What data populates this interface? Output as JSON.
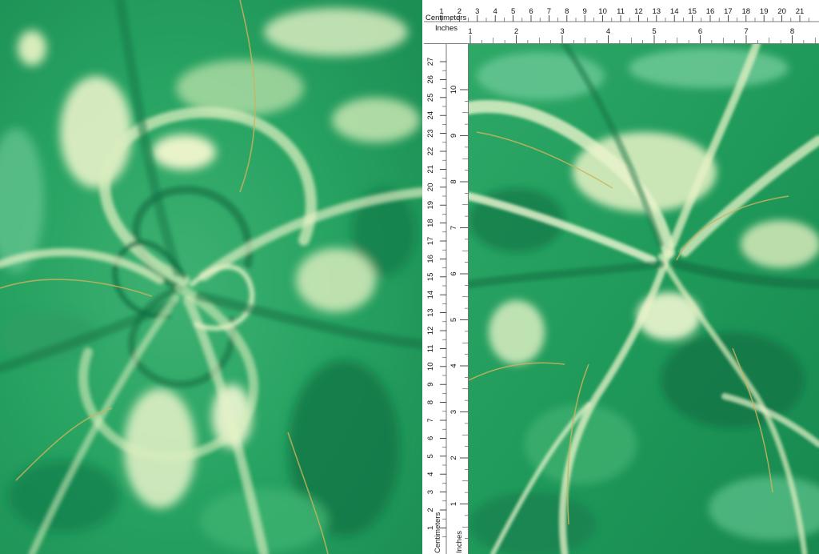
{
  "image": {
    "left_panel": "fabric-swirl-photo",
    "right_panel": "fabric-flat-swatch"
  },
  "palette": {
    "deep_green": "#0f7a48",
    "mid_green": "#2aa565",
    "light_green": "#5cc88b",
    "pale_cream": "#e9f3c7",
    "gold_vein": "#cdb35a"
  },
  "ruler": {
    "top_cm_label": "Centimeters",
    "top_in_label": "Inches",
    "side_cm_label": "Centimeters",
    "side_in_label": "Inches",
    "top_cm_ticks": [
      "1",
      "2",
      "3",
      "4",
      "5",
      "6",
      "7",
      "8",
      "9",
      "10",
      "11",
      "12",
      "13",
      "14",
      "15",
      "16",
      "17",
      "18",
      "19",
      "20",
      "21"
    ],
    "top_in_ticks": [
      "1",
      "2",
      "3",
      "4",
      "5",
      "6",
      "7",
      "8"
    ],
    "side_cm_ticks": [
      "27",
      "26",
      "25",
      "24",
      "23",
      "22",
      "21",
      "20",
      "19",
      "18",
      "17",
      "16",
      "15",
      "14",
      "13",
      "12",
      "11",
      "10",
      "9",
      "8",
      "7",
      "6",
      "5",
      "4",
      "3",
      "2",
      "1"
    ],
    "side_in_ticks": [
      "10",
      "9",
      "8",
      "7",
      "6",
      "5",
      "4",
      "3",
      "2",
      "1"
    ]
  }
}
